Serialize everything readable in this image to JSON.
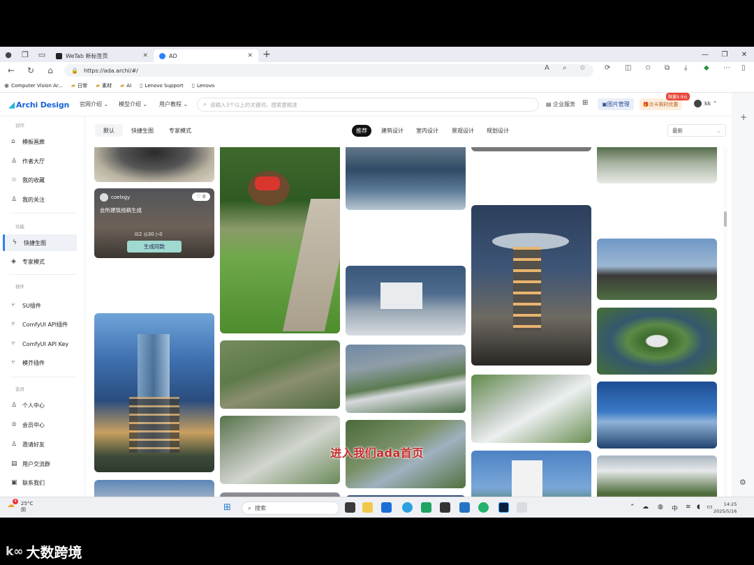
{
  "browser": {
    "tabs": [
      {
        "label": "WeTab 新标签页",
        "favicon_color": "#222222"
      },
      {
        "label": "AD",
        "favicon_color": "#2a82ff"
      }
    ],
    "url": "https://ada.archi/#/",
    "bookmarks": [
      {
        "label": "Computer Vision Ar...",
        "icon": "ai-icon"
      },
      {
        "label": "日常",
        "icon": "folder-icon"
      },
      {
        "label": "素材",
        "icon": "folder-icon"
      },
      {
        "label": "AI",
        "icon": "folder-icon"
      },
      {
        "label": "Lenovo Support",
        "icon": "page-icon"
      },
      {
        "label": "Lenovo",
        "icon": "page-icon"
      }
    ]
  },
  "site": {
    "logo": "Archi Design",
    "nav": [
      "官网介绍",
      "模型介绍",
      "用户教程"
    ],
    "search_placeholder": "请输入3个以上的关键词，搜索更精准",
    "enterprise": "企业服务",
    "image_manager": "图片管理",
    "promo": "次卡限时优惠",
    "promo_badge": "限量9.9元",
    "user": "kk"
  },
  "sidebar": {
    "sections": [
      {
        "title": "创作",
        "items": [
          {
            "label": "模板画廊",
            "icon": "home-icon"
          },
          {
            "label": "作者大厅",
            "icon": "user-icon"
          },
          {
            "label": "我的收藏",
            "icon": "star-icon"
          },
          {
            "label": "我的关注",
            "icon": "follow-icon"
          }
        ]
      },
      {
        "title": "功能",
        "items": [
          {
            "label": "快捷生图",
            "icon": "bolt-icon",
            "active": true
          },
          {
            "label": "专家模式",
            "icon": "gem-icon"
          }
        ]
      },
      {
        "title": "插件",
        "items": [
          {
            "label": "SU插件",
            "icon": "plug-icon"
          },
          {
            "label": "ComfyUI API插件",
            "icon": "plug-icon"
          },
          {
            "label": "ComfyUI API Key",
            "icon": "plug-icon"
          },
          {
            "label": "模芥插件",
            "icon": "plug-icon"
          }
        ]
      },
      {
        "title": "会员",
        "items": [
          {
            "label": "个人中心",
            "icon": "user-icon"
          },
          {
            "label": "会员中心",
            "icon": "crown-icon"
          },
          {
            "label": "邀请好友",
            "icon": "invite-icon"
          },
          {
            "label": "用户交流群",
            "icon": "chat-icon"
          },
          {
            "label": "联系我们",
            "icon": "contact-icon"
          }
        ]
      }
    ]
  },
  "filters": {
    "modes": [
      "默认",
      "快捷生图",
      "专家模式"
    ],
    "categories": [
      "推荐",
      "建筑设计",
      "室内设计",
      "景观设计",
      "规划设计"
    ],
    "sort": "最新"
  },
  "card": {
    "user": "coelxgy",
    "likes": "0",
    "title": "会所建筑线稿生成",
    "stats": [
      "2",
      "30",
      "0"
    ],
    "button": "生成同款"
  },
  "subtitle": "进入我们ada首页",
  "taskbar": {
    "weather_temp": "25°C",
    "weather_cond": "阴",
    "weather_badge": "4",
    "search": "搜索",
    "ime": "中",
    "time": "14:25",
    "date": "2025/5/16"
  },
  "watermark": "大数跨境"
}
